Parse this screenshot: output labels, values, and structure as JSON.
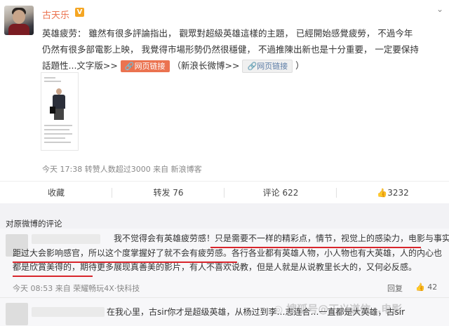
{
  "post": {
    "username": "古天乐",
    "vip_badge": "V",
    "line1": "英雄疲劳：  雖然有很多評論指出，  觀眾對超級英雄這樣的主題，  已經開始感覺疲勞，  不過今年",
    "line2": "仍然有很多部電影上映，  我覺得市場形勢仍然很穩健，  不過推陳出新也是十分重要，  一定要保持",
    "line3_prefix": "話題性...文字版>>",
    "link_btn_1": "网页链接",
    "line3_mid": "（新浪长微博>>",
    "link_btn_2": "网页链接",
    "line3_suffix": "）",
    "meta": "今天 17:38 转赞人数超过3000 来自 新浪博客"
  },
  "actions": {
    "favorite": "收藏",
    "repost": "转发 76",
    "comment": "评论 622",
    "like": "3232"
  },
  "comments": {
    "title": "对原微博的评论",
    "c1": {
      "line1": "我不觉得会有英雄疲劳感！只是需要不一样的精彩点，情节，视觉上的感染力，电影与事实差",
      "line2": "距过大会影响感官，所以这个度掌握好了就不会有疲劳感。各行各业都有英雄人物，小人物也有大英雄，人的内心也",
      "line3": "都是欣賞美得的，期待更多展现真善美的影片，有人不喜欢说教，但是人就是从说教里长大的，又何必反感。",
      "meta": "今天 08:53 来自 荣耀畅玩4X·快科技",
      "reply": "回复",
      "likes": "42"
    },
    "c2": {
      "text": "在我心里，古sir你才是超级英雄，从杨过到李…志连合…一直都是大英雄，古sir"
    }
  },
  "watermark": "◎ 搜狐号@正义道信…电影"
}
